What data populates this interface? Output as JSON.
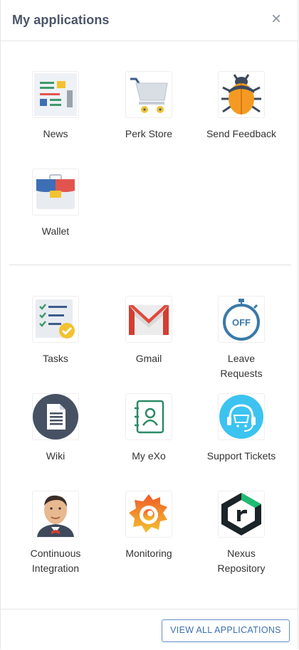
{
  "header": {
    "title": "My applications",
    "close_label": "×"
  },
  "favorites": [
    {
      "label": "News",
      "icon": "news-icon"
    },
    {
      "label": "Perk Store",
      "icon": "perk-store-cart-icon"
    },
    {
      "label": "Send Feedback",
      "icon": "bug-icon"
    },
    {
      "label": "Wallet",
      "icon": "wallet-icon"
    }
  ],
  "apps": [
    {
      "label": "Tasks",
      "icon": "tasks-icon"
    },
    {
      "label": "Gmail",
      "icon": "gmail-icon"
    },
    {
      "label": "Leave Requests",
      "icon": "stopwatch-off-icon"
    },
    {
      "label": "Wiki",
      "icon": "wiki-document-icon"
    },
    {
      "label": "My eXo",
      "icon": "contact-book-icon"
    },
    {
      "label": "Support Tickets",
      "icon": "headset-support-icon"
    },
    {
      "label": "Continuous Integration",
      "icon": "jenkins-icon"
    },
    {
      "label": "Monitoring",
      "icon": "grafana-icon"
    },
    {
      "label": "Nexus Repository",
      "icon": "nexus-icon"
    }
  ],
  "footer": {
    "view_all_label": "VIEW ALL APPLICATIONS"
  },
  "colors": {
    "accent": "#3a6fb0",
    "title": "#4a5568"
  }
}
